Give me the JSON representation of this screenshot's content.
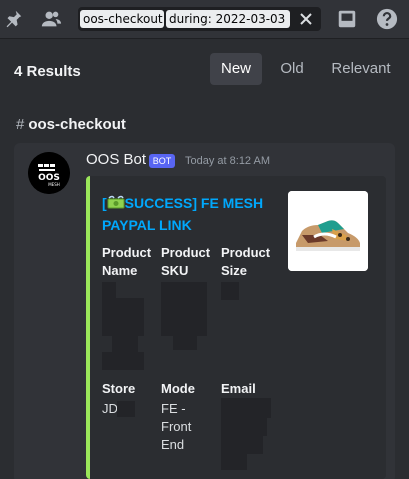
{
  "search": {
    "channel_filter": "oos-checkout",
    "date_filter": "during: 2022-03-03"
  },
  "results": {
    "count_label": "4 Results",
    "sort_tabs": [
      {
        "label": "New",
        "active": true
      },
      {
        "label": "Old",
        "active": false
      },
      {
        "label": "Relevant",
        "active": false
      }
    ]
  },
  "channel": {
    "name": "oos-checkout"
  },
  "message": {
    "author": "OOS Bot",
    "badge": "BOT",
    "timestamp": "Today at 8:12 AM",
    "avatar_text": "OOS",
    "avatar_subtext": "MESH",
    "embed": {
      "accent_color": "#9be75a",
      "title": "[💸 SUCCESS] FE MESH PAYPAL LINK",
      "title_prefix": "[",
      "title_rest": "SUCCESS] FE MESH PAYPAL LINK",
      "fields": [
        {
          "name": "Product Name",
          "value": ""
        },
        {
          "name": "Product SKU",
          "value": ""
        },
        {
          "name": "Product Size",
          "value": ""
        },
        {
          "name": "Store",
          "value": "JD"
        },
        {
          "name": "Mode",
          "value": "FE - Front End"
        },
        {
          "name": "Email",
          "value": ""
        }
      ]
    }
  },
  "icons": {
    "pin": "pin-icon",
    "members": "members-icon",
    "clear": "close-icon",
    "inbox": "inbox-icon",
    "help": "help-icon"
  }
}
